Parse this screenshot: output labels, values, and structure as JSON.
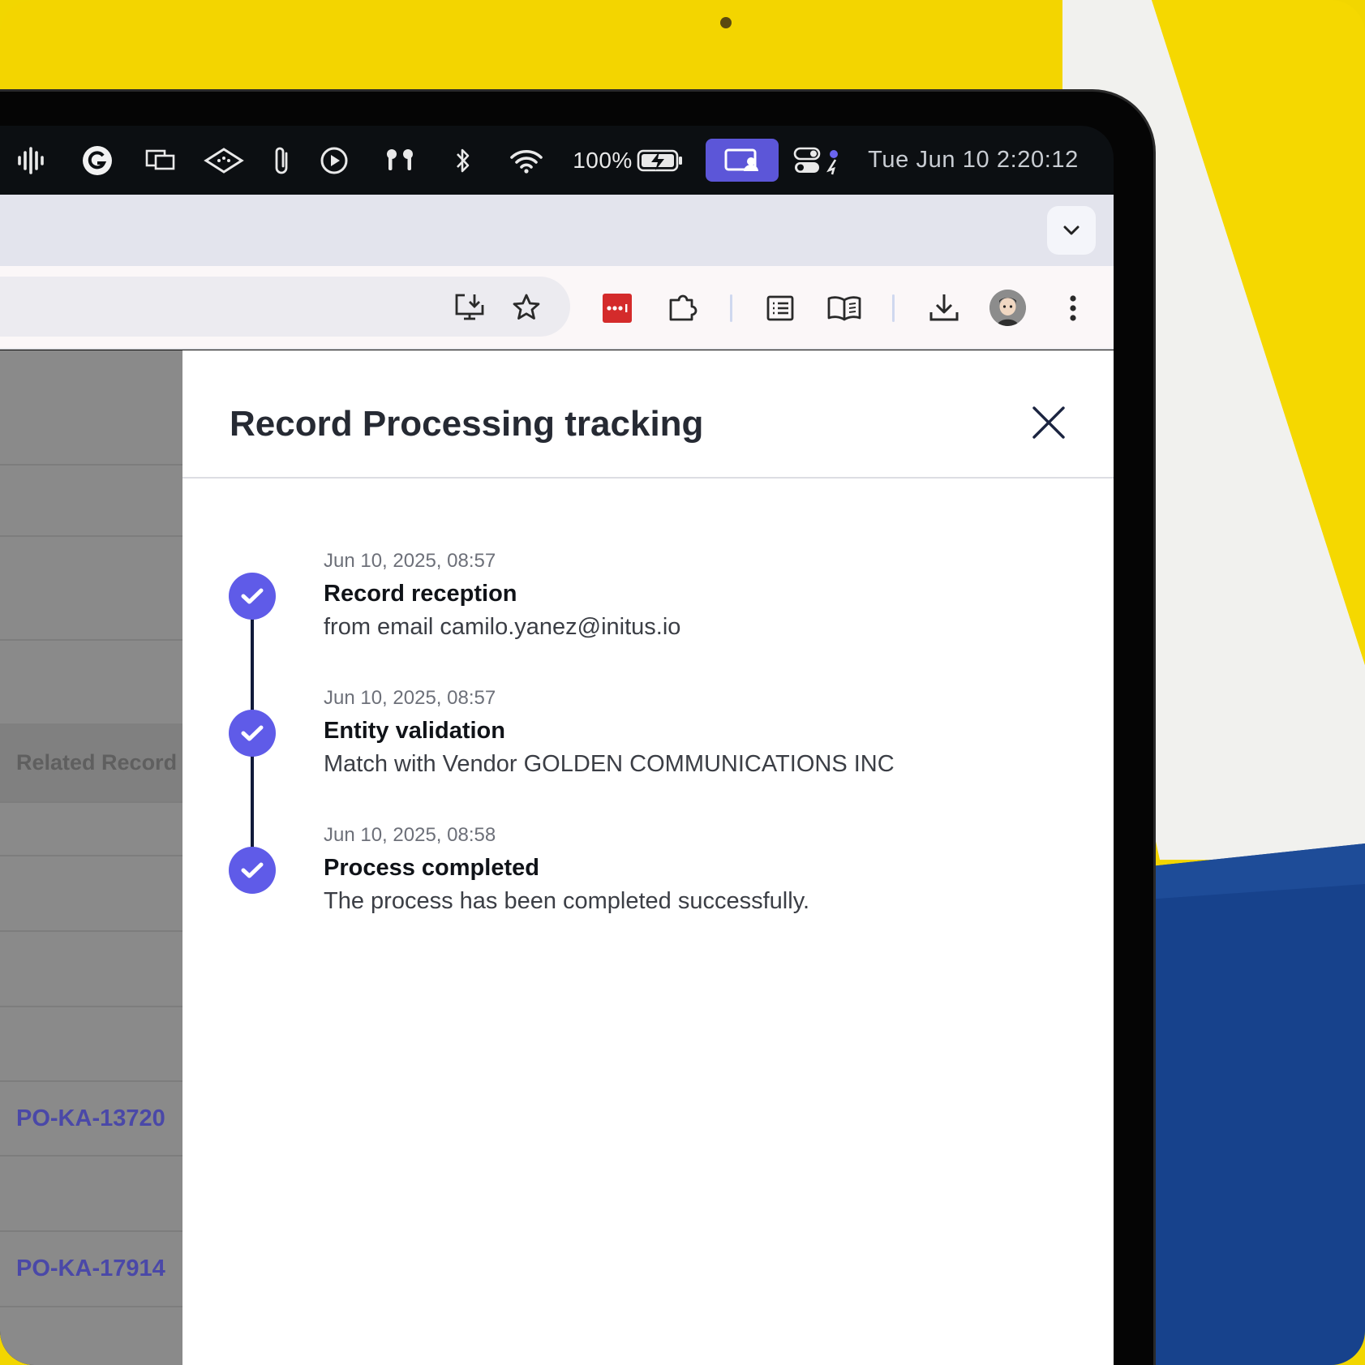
{
  "menubar": {
    "battery_percent": "100%",
    "clock": "Tue Jun 10  2:20:12"
  },
  "drawer": {
    "title": "Record Processing tracking",
    "steps": [
      {
        "date": "Jun 10, 2025, 08:57",
        "title": "Record reception",
        "description": "from email camilo.yanez@initus.io"
      },
      {
        "date": "Jun 10, 2025, 08:57",
        "title": "Entity validation",
        "description": "Match with Vendor GOLDEN COMMUNICATIONS INC"
      },
      {
        "date": "Jun 10, 2025, 08:58",
        "title": "Process completed",
        "description": "The process has been completed successfully."
      }
    ]
  },
  "background_table": {
    "column_header": "Related Record",
    "links": [
      "PO-KA-13720",
      "PO-KA-17914"
    ]
  },
  "colors": {
    "accent": "#5f5be8",
    "menubar_active": "#5c56d8",
    "timeline_line": "#101a3a",
    "record_icon": "#d42b2b"
  },
  "icons": {
    "menubar": [
      "audio-waveform-icon",
      "grammarly-icon",
      "screens-icon",
      "stream-deck-icon",
      "paperclip-icon",
      "play-circle-icon",
      "airpods-icon",
      "bluetooth-icon",
      "wifi-icon",
      "battery-charging-icon",
      "screen-share-icon",
      "control-center-icon"
    ],
    "toolbar": [
      "install-app-icon",
      "bookmark-star-icon",
      "password-manager-icon",
      "extensions-icon",
      "reading-list-icon",
      "reader-mode-icon",
      "download-icon",
      "profile-avatar",
      "more-vert-icon"
    ]
  }
}
